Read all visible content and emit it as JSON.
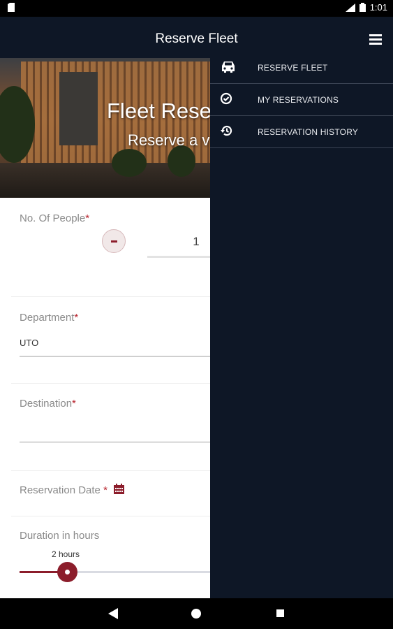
{
  "status_bar": {
    "time": "1:01"
  },
  "app_bar": {
    "title": "Reserve Fleet"
  },
  "hero": {
    "title": "Fleet Rese",
    "subtitle": "Reserve a v"
  },
  "form": {
    "people": {
      "label": "No. Of People",
      "required": "*",
      "value": "1"
    },
    "department": {
      "label": "Department",
      "required": "*",
      "value": "UTO"
    },
    "destination": {
      "label": "Destination",
      "required": "*"
    },
    "reservation_date": {
      "label": "Reservation Date",
      "required": "*"
    },
    "duration": {
      "label": "Duration in hours",
      "value_label": "2 hours"
    }
  },
  "drawer": {
    "items": [
      {
        "label": "RESERVE FLEET",
        "icon": "car-icon"
      },
      {
        "label": "MY RESERVATIONS",
        "icon": "check-circle-icon"
      },
      {
        "label": "RESERVATION HISTORY",
        "icon": "history-icon"
      }
    ]
  },
  "colors": {
    "primary": "#8c1d2b",
    "drawer_bg": "#0e1726",
    "required": "#b8242e"
  }
}
